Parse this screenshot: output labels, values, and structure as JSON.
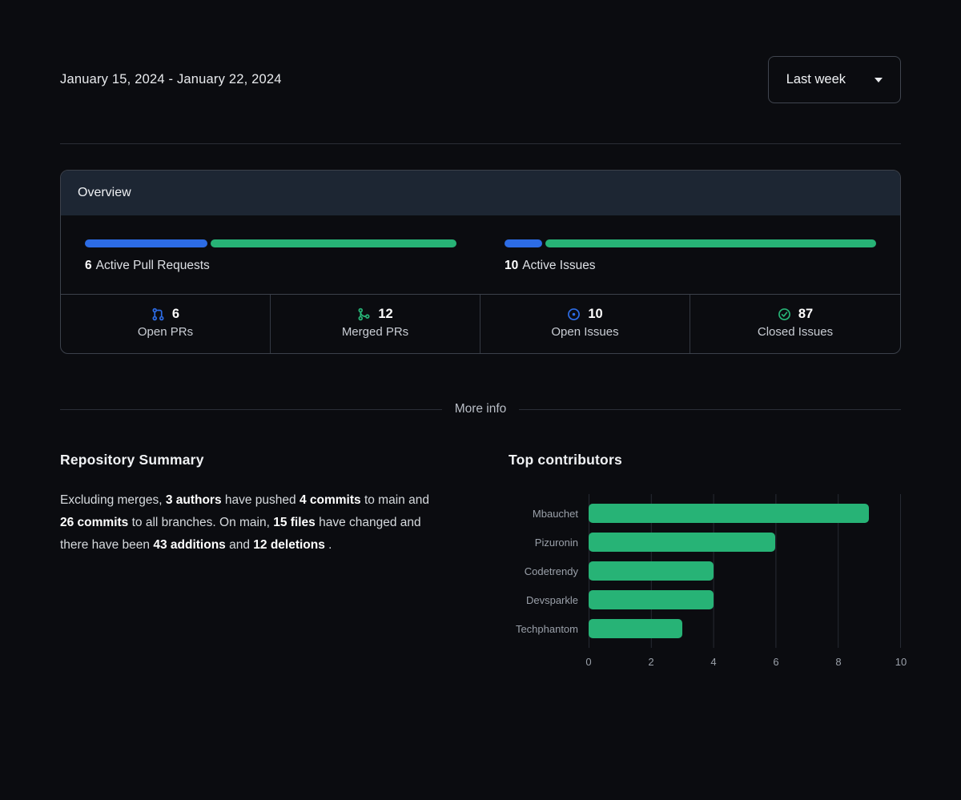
{
  "colors": {
    "blue": "#2d6ce5",
    "green": "#27b376"
  },
  "header": {
    "date_range": "January 15, 2024 - January 22, 2024",
    "period_selected": "Last week"
  },
  "overview": {
    "title": "Overview",
    "active_prs": {
      "value": "6",
      "label": "Active Pull Requests",
      "open_pct": 33.3,
      "merged_pct": 66.7
    },
    "active_issues": {
      "value": "10",
      "label": "Active Issues",
      "open_pct": 10.3,
      "closed_pct": 89.7
    },
    "stats": [
      {
        "icon": "git-pull-request-icon",
        "value": "6",
        "label": "Open PRs",
        "color": "#2d6ce5"
      },
      {
        "icon": "git-merge-icon",
        "value": "12",
        "label": "Merged PRs",
        "color": "#27b376"
      },
      {
        "icon": "issue-open-icon",
        "value": "10",
        "label": "Open Issues",
        "color": "#2d6ce5"
      },
      {
        "icon": "issue-closed-icon",
        "value": "87",
        "label": "Closed Issues",
        "color": "#27b376"
      }
    ]
  },
  "divider": {
    "label": "More info"
  },
  "repository_summary": {
    "title": "Repository Summary",
    "segments": [
      {
        "text": "Excluding merges, ",
        "bold": false
      },
      {
        "text": "3 authors",
        "bold": true
      },
      {
        "text": " have pushed ",
        "bold": false
      },
      {
        "text": "4 commits",
        "bold": true
      },
      {
        "text": " to main and ",
        "bold": false
      },
      {
        "text": "26 commits",
        "bold": true
      },
      {
        "text": " to all branches. On main, ",
        "bold": false
      },
      {
        "text": "15 files",
        "bold": true
      },
      {
        "text": " have changed and there have been ",
        "bold": false
      },
      {
        "text": "43 additions",
        "bold": true
      },
      {
        "text": " and ",
        "bold": false
      },
      {
        "text": "12 deletions",
        "bold": true
      },
      {
        "text": " .",
        "bold": false
      }
    ]
  },
  "top_contributors": {
    "title": "Top contributors"
  },
  "chart_data": {
    "type": "bar",
    "orientation": "horizontal",
    "title": "Top contributors",
    "categories": [
      "Mbauchet",
      "Pizuronin",
      "Codetrendy",
      "Devsparkle",
      "Techphantom"
    ],
    "values": [
      9,
      6,
      4,
      4,
      3
    ],
    "xlabel": "",
    "ylabel": "",
    "xlim": [
      0,
      10
    ],
    "xticks": [
      0,
      2,
      4,
      6,
      8,
      10
    ],
    "bar_color": "#27b376",
    "grid": true,
    "legend": false
  }
}
